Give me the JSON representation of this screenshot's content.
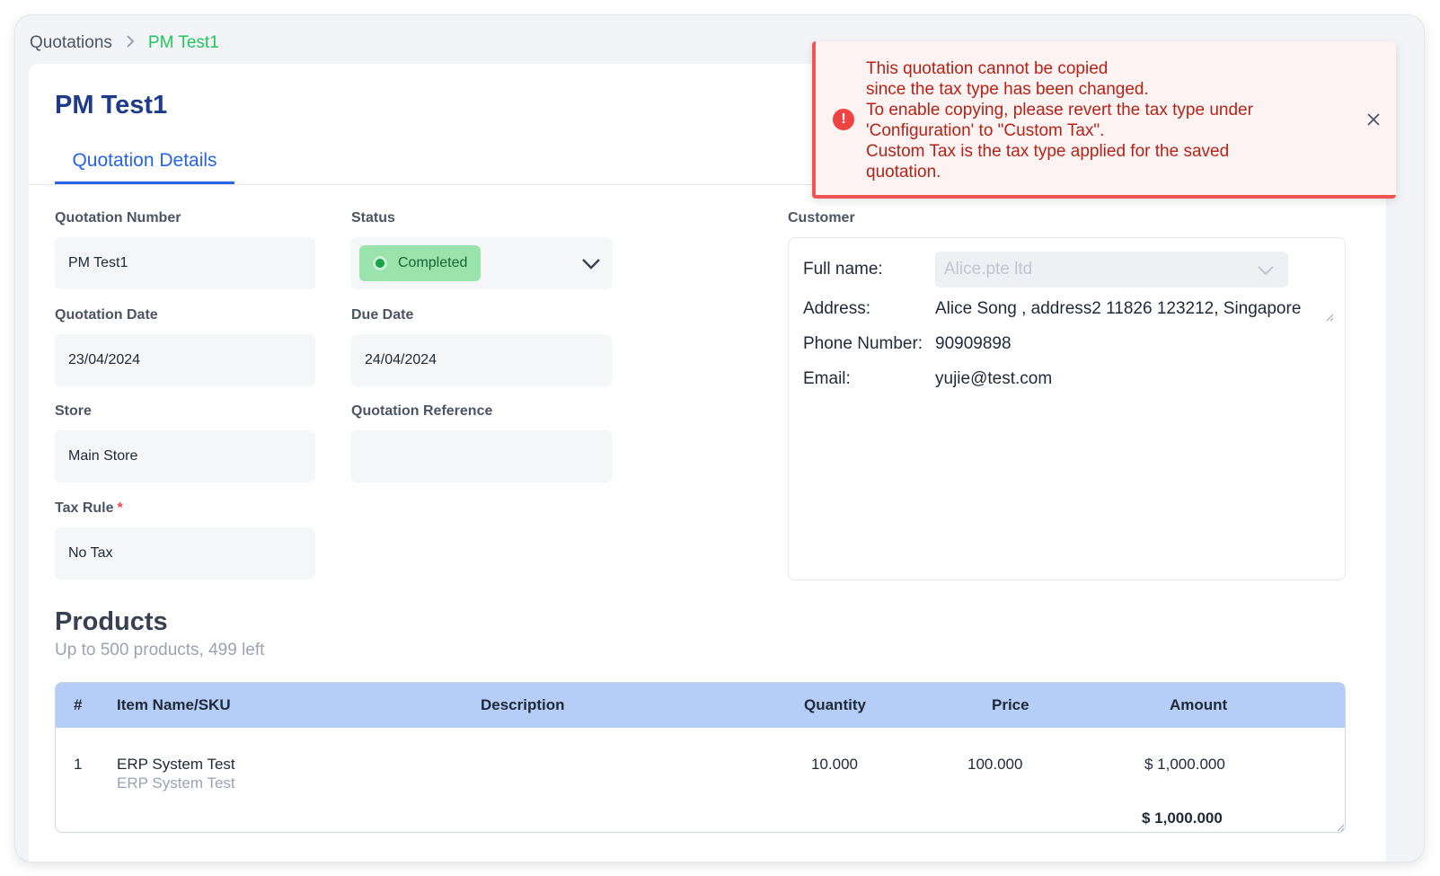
{
  "breadcrumb": {
    "root": "Quotations",
    "current": "PM Test1"
  },
  "page": {
    "title": "PM Test1",
    "tab_label": "Quotation Details"
  },
  "form": {
    "quotation_number": {
      "label": "Quotation Number",
      "value": "PM Test1"
    },
    "status": {
      "label": "Status",
      "value": "Completed"
    },
    "quotation_date": {
      "label": "Quotation Date",
      "value": "23/04/2024"
    },
    "due_date": {
      "label": "Due Date",
      "value": "24/04/2024"
    },
    "store": {
      "label": "Store",
      "value": "Main Store"
    },
    "quotation_reference": {
      "label": "Quotation Reference",
      "value": ""
    },
    "tax_rule": {
      "label": "Tax Rule",
      "required_mark": "*",
      "value": "No Tax"
    }
  },
  "customer": {
    "label": "Customer",
    "full_name_label": "Full name:",
    "full_name_placeholder": "Alice.pte ltd",
    "address_label": "Address:",
    "address_value": "Alice Song , address2 11826 123212, Singapore",
    "phone_label": "Phone Number:",
    "phone_value": "90909898",
    "email_label": "Email:",
    "email_value": "yujie@test.com"
  },
  "products": {
    "title": "Products",
    "subtitle": "Up to 500 products, 499 left",
    "columns": [
      "#",
      "Item Name/SKU",
      "Description",
      "Quantity",
      "Price",
      "Amount"
    ],
    "rows": [
      {
        "index": "1",
        "item_name": "ERP System Test",
        "sku": "ERP System Test",
        "description": "",
        "quantity": "10.000",
        "price": "100.000",
        "amount": "$ 1,000.000"
      }
    ],
    "total": "$ 1,000.000"
  },
  "toast": {
    "icon": "!",
    "lines": [
      "This quotation cannot be copied",
      "since the tax type has been changed.",
      "To enable copying, please revert the tax type under",
      "'Configuration' to \"Custom Tax\".",
      "Custom Tax is the tax type applied for the saved",
      "quotation."
    ]
  },
  "colors": {
    "brand_title": "#1e3a8a",
    "accent": "#2563eb",
    "breadcrumb_current": "#22c55e",
    "status_pill": "#9ae3ac",
    "table_header": "#b5cdf7",
    "toast_border": "#f05454",
    "toast_text": "#b42318"
  }
}
